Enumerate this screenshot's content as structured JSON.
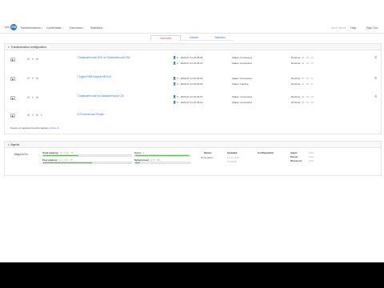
{
  "brand": {
    "name": "Neo",
    "badge": "PDI"
  },
  "nav": {
    "items": [
      {
        "label": "Transformations",
        "caret": "▾"
      },
      {
        "label": "Credentials",
        "caret": "▾"
      },
      {
        "label": "Executors",
        "caret": "▾"
      },
      {
        "label": "Statistics",
        "caret": "▾"
      }
    ],
    "right_faint": "Arno Harms",
    "right_items": [
      "Help",
      "Sign Out"
    ]
  },
  "tabs": [
    {
      "label": "Overview",
      "active": true
    },
    {
      "label": "Jobsets",
      "active": false
    },
    {
      "label": "Statistics",
      "active": false
    }
  ],
  "transformations": {
    "title": "Transformation configuration",
    "rows": [
      {
        "icons": "⚙ ≡ ⚙",
        "link": "7 Datawarehouse DVD on Datawarehouse DW",
        "users": [
          "F · 2024-07-11 15:35:06",
          "F · 2024-07-11 15:35:15"
        ],
        "status": [
          "Status: Connected",
          "Status: Connected"
        ],
        "numbers": [
          {
            "label": "Runtime:",
            "values": "00 : 00 : 15"
          },
          {
            "label": "Runtime:",
            "values": "00 : 00 : 15"
          }
        ]
      },
      {
        "icons": "⚙ ≡ ⚙",
        "link": "7 Digital PMB Insights NEXUS",
        "users": [
          "F · 2024-07-11 15:34:02",
          "F · 2024-07-11 15:34:05"
        ],
        "status": [
          "Status: Connected",
          "Status: Inactive"
        ],
        "numbers": [
          {
            "label": "Runtime:",
            "values": "00 : 00 : 11"
          },
          {
            "label": "Runtime:",
            "values": "00 : 00 : 11"
          }
        ]
      },
      {
        "icons": "⚙ ≡ ⚙",
        "link": "7 Datawarehouse on Datawarehouse CDI",
        "users": [
          "F · 2024-07-11 15:33:07",
          "F · 2024-07-11 15:33:10"
        ],
        "status": [
          "Status: Connected",
          "Status: Connected"
        ],
        "numbers": [
          {
            "label": "Runtime:",
            "values": "00 : 00 : 09"
          },
          {
            "label": "Runtime:",
            "values": "00 : 00 : 09"
          }
        ]
      },
      {
        "icons": "⚙ ≡ ⚙ ≡",
        "link": "10 Products and People",
        "users": [],
        "status": [],
        "numbers": []
      }
    ],
    "footer_label": "Source of selected transformations:",
    "footer_link": "Active",
    "footer_count": "4"
  },
  "agents": {
    "title": "Agents",
    "name": "Mega Al Db",
    "metrics_left": [
      {
        "label": "Used memory",
        "value": "0.7 / 3.6 · 75",
        "fill": 0.4
      },
      {
        "label": "Free memory",
        "value": "2.1 / 3.6 · 75",
        "fill": 0.55
      }
    ],
    "metrics_mid": [
      {
        "label": "Cores",
        "value": "8",
        "fill": 0.98
      },
      {
        "label": "System load",
        "value": "0.73 · 8%",
        "fill": 0.09
      }
    ],
    "status_head": "Status",
    "status_val": "Connected",
    "updated_head": "Updated",
    "updated_val1": "11.07.2024",
    "updated_val2": "15:35:06",
    "config_head": "Configuration",
    "kv": [
      {
        "key": "Agent",
        "val": "Alles"
      },
      {
        "key": "Parser",
        "val": "Alles"
      },
      {
        "key": "Processor",
        "val": "Alles"
      }
    ]
  }
}
